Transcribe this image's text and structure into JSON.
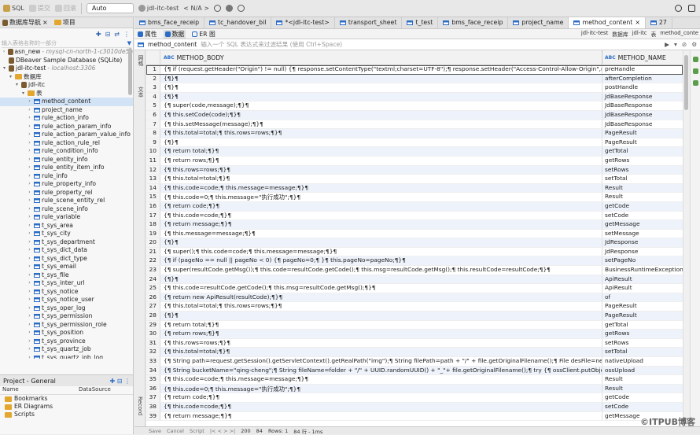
{
  "toolbar": {
    "sql_label": "SQL",
    "submit_label": "提交",
    "rollback_label": "回滚",
    "txn_mode": "Auto",
    "connection": "jdl-itc-test",
    "schema": "< N/A >"
  },
  "left_panel": {
    "tab_db_nav": "数据库导航",
    "tab_project": "项目",
    "filter_placeholder": "输入表格名称的一部分",
    "tree": [
      {
        "label": "asn_new",
        "note": "- mysql-cn-north-1-c3010de5a",
        "level": 0,
        "kind": "conn",
        "arrow": ">"
      },
      {
        "label": "DBeaver Sample Database (SQLite)",
        "note": "",
        "level": 0,
        "kind": "conn",
        "arrow": ""
      },
      {
        "label": "jdl-itc-test",
        "note": "- localhost:3306",
        "level": 0,
        "kind": "conn",
        "arrow": "v"
      },
      {
        "label": "数据库",
        "note": "",
        "level": 1,
        "kind": "folder",
        "arrow": "v"
      },
      {
        "label": "jdl-itc",
        "note": "",
        "level": 2,
        "kind": "db",
        "arrow": "v"
      },
      {
        "label": "表",
        "note": "",
        "level": 3,
        "kind": "folder",
        "arrow": "v"
      },
      {
        "label": "method_content",
        "note": "",
        "level": 4,
        "kind": "table",
        "arrow": ">",
        "selected": true
      },
      {
        "label": "project_name",
        "note": "",
        "level": 4,
        "kind": "table",
        "arrow": ">"
      },
      {
        "label": "rule_action_info",
        "note": "",
        "level": 4,
        "kind": "table",
        "arrow": ">"
      },
      {
        "label": "rule_action_param_info",
        "note": "",
        "level": 4,
        "kind": "table",
        "arrow": ">"
      },
      {
        "label": "rule_action_param_value_info",
        "note": "",
        "level": 4,
        "kind": "table",
        "arrow": ">"
      },
      {
        "label": "rule_action_rule_rel",
        "note": "",
        "level": 4,
        "kind": "table",
        "arrow": ">"
      },
      {
        "label": "rule_condition_info",
        "note": "",
        "level": 4,
        "kind": "table",
        "arrow": ">"
      },
      {
        "label": "rule_entity_info",
        "note": "",
        "level": 4,
        "kind": "table",
        "arrow": ">"
      },
      {
        "label": "rule_entity_item_info",
        "note": "",
        "level": 4,
        "kind": "table",
        "arrow": ">"
      },
      {
        "label": "rule_info",
        "note": "",
        "level": 4,
        "kind": "table",
        "arrow": ">"
      },
      {
        "label": "rule_property_info",
        "note": "",
        "level": 4,
        "kind": "table",
        "arrow": ">"
      },
      {
        "label": "rule_property_rel",
        "note": "",
        "level": 4,
        "kind": "table",
        "arrow": ">"
      },
      {
        "label": "rule_scene_entity_rel",
        "note": "",
        "level": 4,
        "kind": "table",
        "arrow": ">"
      },
      {
        "label": "rule_scene_info",
        "note": "",
        "level": 4,
        "kind": "table",
        "arrow": ">"
      },
      {
        "label": "rule_variable",
        "note": "",
        "level": 4,
        "kind": "table",
        "arrow": ">"
      },
      {
        "label": "t_sys_area",
        "note": "",
        "level": 4,
        "kind": "table",
        "arrow": ">"
      },
      {
        "label": "t_sys_city",
        "note": "",
        "level": 4,
        "kind": "table",
        "arrow": ">"
      },
      {
        "label": "t_sys_department",
        "note": "",
        "level": 4,
        "kind": "table",
        "arrow": ">"
      },
      {
        "label": "t_sys_dict_data",
        "note": "",
        "level": 4,
        "kind": "table",
        "arrow": ">"
      },
      {
        "label": "t_sys_dict_type",
        "note": "",
        "level": 4,
        "kind": "table",
        "arrow": ">"
      },
      {
        "label": "t_sys_email",
        "note": "",
        "level": 4,
        "kind": "table",
        "arrow": ">"
      },
      {
        "label": "t_sys_file",
        "note": "",
        "level": 4,
        "kind": "table",
        "arrow": ">"
      },
      {
        "label": "t_sys_inter_url",
        "note": "",
        "level": 4,
        "kind": "table",
        "arrow": ">"
      },
      {
        "label": "t_sys_notice",
        "note": "",
        "level": 4,
        "kind": "table",
        "arrow": ">"
      },
      {
        "label": "t_sys_notice_user",
        "note": "",
        "level": 4,
        "kind": "table",
        "arrow": ">"
      },
      {
        "label": "t_sys_oper_log",
        "note": "",
        "level": 4,
        "kind": "table",
        "arrow": ">"
      },
      {
        "label": "t_sys_permission",
        "note": "",
        "level": 4,
        "kind": "table",
        "arrow": ">"
      },
      {
        "label": "t_sys_permission_role",
        "note": "",
        "level": 4,
        "kind": "table",
        "arrow": ">"
      },
      {
        "label": "t_sys_position",
        "note": "",
        "level": 4,
        "kind": "table",
        "arrow": ">"
      },
      {
        "label": "t_sys_province",
        "note": "",
        "level": 4,
        "kind": "table",
        "arrow": ">"
      },
      {
        "label": "t_sys_quartz_job",
        "note": "",
        "level": 4,
        "kind": "table",
        "arrow": ">"
      },
      {
        "label": "t_sys_quartz_job_log",
        "note": "",
        "level": 4,
        "kind": "table",
        "arrow": ">"
      }
    ],
    "project_panel": {
      "title": "Project - General",
      "col_name": "Name",
      "col_datasource": "DataSource",
      "items": [
        "Bookmarks",
        "ER Diagrams",
        "Scripts"
      ]
    }
  },
  "editor_tabs": [
    {
      "label": "bms_face_receip",
      "active": false
    },
    {
      "label": "tc_handover_bil",
      "active": false
    },
    {
      "label": "*<jdl-itc-test>",
      "active": false
    },
    {
      "label": "transport_sheet",
      "active": false
    },
    {
      "label": "t_test",
      "active": false
    },
    {
      "label": "bms_face_receip",
      "active": false
    },
    {
      "label": "project_name",
      "active": false
    },
    {
      "label": "method_content",
      "active": true
    },
    {
      "label": "27",
      "active": false
    }
  ],
  "sub_tabs": {
    "properties": "属性",
    "data": "数据",
    "er": "ER 图",
    "crumb_conn": "jdl-itc-test",
    "crumb_db_label": "数据库",
    "crumb_db": "jdl-itc",
    "crumb_table_label": "表",
    "crumb_table": "method_conte"
  },
  "filter_bar": {
    "table_name": "method_content",
    "placeholder": "输入一个 SQL 表达式来过滤结果 (使用 Ctrl+Space)"
  },
  "side_labels": {
    "grid": "网格",
    "text": "文本",
    "record": "Record"
  },
  "grid": {
    "col_body": "METHOD_BODY",
    "col_name": "METHOD_NAME",
    "type_tag": "ABC",
    "rows": [
      {
        "n": "1",
        "body": "{¶  if (request.getHeader(\"Origin\") != null) {¶     response.setContentType(\"textml;charset=UTF-8\");¶     response.setHeader(\"Access-Control-Allow-Origin\",re",
        "name": "preHandle"
      },
      {
        "n": "2",
        "body": "{¶}¶",
        "name": "afterCompletion"
      },
      {
        "n": "3",
        "body": "{¶}¶",
        "name": "postHandle"
      },
      {
        "n": "4",
        "body": "{¶}¶",
        "name": "JdBaseResponse"
      },
      {
        "n": "5",
        "body": "{¶  super(code,message);¶}¶",
        "name": "JdBaseResponse"
      },
      {
        "n": "6",
        "body": "{¶  this.setCode(code);¶}¶",
        "name": "JdBaseResponse"
      },
      {
        "n": "7",
        "body": "{¶  this.setMessage(message);¶}¶",
        "name": "JdBaseResponse"
      },
      {
        "n": "8",
        "body": "{¶  this.total=total;¶  this.rows=rows;¶}¶",
        "name": "PageResult"
      },
      {
        "n": "9",
        "body": "{¶}¶",
        "name": "PageResult"
      },
      {
        "n": "10",
        "body": "{¶  return total;¶}¶",
        "name": "getTotal"
      },
      {
        "n": "11",
        "body": "{¶  return rows;¶}¶",
        "name": "getRows"
      },
      {
        "n": "12",
        "body": "{¶  this.rows=rows;¶}¶",
        "name": "setRows"
      },
      {
        "n": "13",
        "body": "{¶  this.total=total;¶}¶",
        "name": "setTotal"
      },
      {
        "n": "14",
        "body": "{¶  this.code=code;¶  this.message=message;¶}¶",
        "name": "Result"
      },
      {
        "n": "15",
        "body": "{¶  this.code=0;¶  this.message=\"执行成功\";¶}¶",
        "name": "Result"
      },
      {
        "n": "16",
        "body": "{¶  return code;¶}¶",
        "name": "getCode"
      },
      {
        "n": "17",
        "body": "{¶  this.code=code;¶}¶",
        "name": "setCode"
      },
      {
        "n": "18",
        "body": "{¶  return message;¶}¶",
        "name": "getMessage"
      },
      {
        "n": "19",
        "body": "{¶  this.message=message;¶}¶",
        "name": "setMessage"
      },
      {
        "n": "20",
        "body": "{¶}¶",
        "name": "JdResponse"
      },
      {
        "n": "21",
        "body": "{¶  super();¶  this.code=code;¶  this.message=message;¶}¶",
        "name": "JdResponse"
      },
      {
        "n": "22",
        "body": "{¶  if (pageNo == null || pageNo < 0) {¶     pageNo=0;¶  }¶  this.pageNo=pageNo;¶}¶",
        "name": "setPageNo"
      },
      {
        "n": "23",
        "body": "{¶  super(resultCode.getMsg());¶  this.code=resultCode.getCode();¶  this.msg=resultCode.getMsg();¶  this.resultCode=resultCode;¶}¶",
        "name": "BusinessRuntimeException"
      },
      {
        "n": "24",
        "body": "{¶}¶",
        "name": "ApiResult"
      },
      {
        "n": "25",
        "body": "{¶  this.code=resultCode.getCode();¶  this.msg=resultCode.getMsg();¶}¶",
        "name": "ApiResult"
      },
      {
        "n": "26",
        "body": "{¶  return new ApiResult(resultCode);¶}¶",
        "name": "of"
      },
      {
        "n": "27",
        "body": "{¶  this.total=total;¶  this.rows=rows;¶}¶",
        "name": "PageResult"
      },
      {
        "n": "28",
        "body": "{¶}¶",
        "name": "PageResult"
      },
      {
        "n": "29",
        "body": "{¶  return total;¶}¶",
        "name": "getTotal"
      },
      {
        "n": "30",
        "body": "{¶  return rows;¶}¶",
        "name": "getRows"
      },
      {
        "n": "31",
        "body": "{¶  this.rows=rows;¶}¶",
        "name": "setRows"
      },
      {
        "n": "32",
        "body": "{¶  this.total=total;¶}¶",
        "name": "setTotal"
      },
      {
        "n": "33",
        "body": "{¶  String path=request.getSession().getServletContext().getRealPath(\"img\");¶  String filePath=path + \"/\" + file.getOriginalFilename();¶  File desFile=new File(",
        "name": "nativeUpload"
      },
      {
        "n": "34",
        "body": "{¶  String bucketName=\"qing-cheng\";¶  String fileName=folder + \"/\" + UUID.randomUUID() + \"_\"+ file.getOriginalFilename();¶  try {¶     ossClient.putObject(bu",
        "name": "ossUpload"
      },
      {
        "n": "35",
        "body": "{¶  this.code=code;¶  this.message=message;¶}¶",
        "name": "Result"
      },
      {
        "n": "36",
        "body": "{¶  this.code=0;¶  this.message=\"执行成功\";¶}¶",
        "name": "Result"
      },
      {
        "n": "37",
        "body": "{¶  return code;¶}¶",
        "name": "getCode"
      },
      {
        "n": "38",
        "body": "{¶  this.code=code;¶}¶",
        "name": "setCode"
      },
      {
        "n": "39",
        "body": "{¶  return message;¶}¶",
        "name": "getMessage"
      }
    ]
  },
  "status": {
    "save": "Save",
    "cancel": "Cancel",
    "script": "Script",
    "fetch_size": "200",
    "count": "84",
    "rows": "Rows: 1",
    "fetched": "84 行 - 1ms"
  },
  "watermark": "©ITPUB博客",
  "colors": {
    "accent": "#2b6cc4",
    "selected": "#d3e3f6",
    "alt_row": "#eef3fb"
  }
}
